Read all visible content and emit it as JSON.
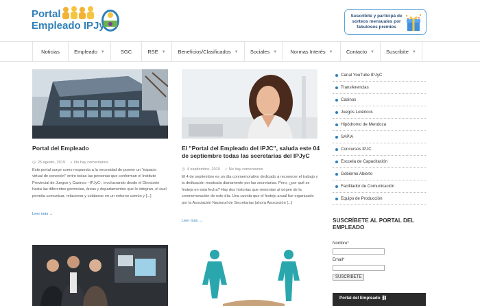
{
  "brand": {
    "logo_line1": "Portal",
    "logo_line2": "Empleado IPJyC",
    "promo_text": "Suscribite y participá de sorteos mensuales por fabulosos premios"
  },
  "nav": {
    "items": [
      {
        "label": "Noticias",
        "caret": false
      },
      {
        "label": "Empleado",
        "caret": true
      },
      {
        "label": "SGC",
        "caret": false
      },
      {
        "label": "RSE",
        "caret": true
      },
      {
        "label": "Beneficios/Clasificados",
        "caret": true
      },
      {
        "label": "Sociales",
        "caret": true
      },
      {
        "label": "Normas Interés",
        "caret": true
      },
      {
        "label": "Contacto",
        "caret": true
      },
      {
        "label": "Suscribite",
        "caret": true
      }
    ]
  },
  "posts": [
    {
      "title": "Portal del Empleado",
      "date": "25 agosto, 2019",
      "comments": "No hay comentarios",
      "excerpt": "Este portal surge como respuesta a la necesidad de poseer un \"espacio virtual de conexión\" entre todas las personas que conforman el Instituto Provincial de Juegos y Casinos –IPJyC-, involucrando desde el Directorio hasta las diferentes gerencias, áreas y departamentos que lo integran, el cual permita comunicar, relacionar y colaborar en un entorno común y [...]",
      "read_more": "Leer más →"
    },
    {
      "title": "El \"Portal del Empleado del IPJC\", saluda este 04 de septiembre todas las secretarias del IPJyC",
      "date": "4 septiembre, 2019",
      "comments": "No hay comentarios",
      "excerpt": "El 4 de septiembre es un día conmemorativo dedicado a reconocer el trabajo y la dedicación mostrada diariamente por las secretarias. Pero, ¿por qué se festeja en esta fecha? Hay dos historias que remontan al origen de la conmemoración de este día. Una cuenta que el festejo anual fue organizado por la Asociación Nacional de Secretarias (ahora Asociación [...]",
      "read_more": "Leer más →"
    }
  ],
  "sidebar": {
    "links": [
      "Canal YouTube IPJyC",
      "Transferencias",
      "Casinos",
      "Juegos Lotéricos",
      "Hipódromo de Mendoza",
      "SAPIA",
      "Concursos IPJC",
      "Escuela de Capacitación",
      "Gobierno Abierto",
      "Facilitador de Comunicación",
      "Equipo de Producción"
    ],
    "subscribe_heading": "SUSCRÍBETE AL PORTAL DEL EMPLEADO",
    "name_label": "Nombre*",
    "email_label": "Email*",
    "subscribe_button": "SUSCRIBETE",
    "widget_title": "Portal del Empleado"
  },
  "colors": {
    "brand_blue": "#2f7fb8",
    "figure_teal": "#2aa6ad"
  }
}
